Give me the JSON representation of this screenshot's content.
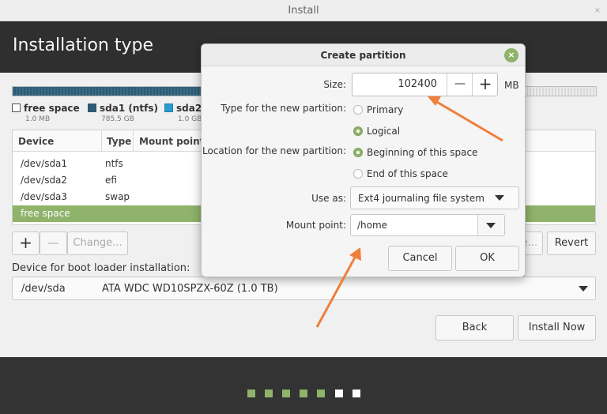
{
  "window": {
    "title": "Install",
    "close_glyph": "×"
  },
  "header": {
    "title": "Installation type"
  },
  "disk": {
    "legend": [
      {
        "name": "free space",
        "size": "1.0 MB",
        "color": "#ffffff"
      },
      {
        "name": "sda1 (ntfs)",
        "size": "785.5 GB",
        "color": "#2d5a74"
      },
      {
        "name": "sda2",
        "size": "1.0 GB",
        "color": "#2a9bd0"
      }
    ]
  },
  "table": {
    "columns": [
      "Device",
      "Type",
      "Mount point"
    ],
    "rows": [
      {
        "device": "/dev/sda1",
        "type": "ntfs"
      },
      {
        "device": "/dev/sda2",
        "type": "efi"
      },
      {
        "device": "/dev/sda3",
        "type": "swap"
      },
      {
        "device": "free space",
        "type": ""
      }
    ],
    "partial_row_text": "free space"
  },
  "table_buttons": {
    "add": "+",
    "remove": "—",
    "change": "Change...",
    "new_table_partial": "e...",
    "revert": "Revert"
  },
  "boot": {
    "label": "Device for boot loader installation:",
    "device": "/dev/sda",
    "description": "ATA WDC WD10SPZX-60Z (1.0 TB)"
  },
  "nav": {
    "back": "Back",
    "install_now": "Install Now"
  },
  "progress_dots": [
    {
      "state": "done",
      "color": "#8fb36a"
    },
    {
      "state": "done",
      "color": "#8fb36a"
    },
    {
      "state": "done",
      "color": "#8fb36a"
    },
    {
      "state": "done",
      "color": "#8fb36a"
    },
    {
      "state": "done",
      "color": "#8fb36a"
    },
    {
      "state": "todo",
      "color": "#ffffff"
    },
    {
      "state": "todo",
      "color": "#ffffff"
    }
  ],
  "dialog": {
    "title": "Create partition",
    "close_glyph": "×",
    "size_label": "Size:",
    "size_value": "102400",
    "size_unit": "MB",
    "minus": "—",
    "plus": "+",
    "type_label": "Type for the new partition:",
    "type_options": [
      "Primary",
      "Logical"
    ],
    "type_selected": "Logical",
    "location_label": "Location for the new partition:",
    "location_options": [
      "Beginning of this space",
      "End of this space"
    ],
    "location_selected": "Beginning of this space",
    "use_as_label": "Use as:",
    "use_as_value": "Ext4 journaling file system",
    "mount_label": "Mount point:",
    "mount_value": "/home",
    "cancel": "Cancel",
    "ok": "OK"
  },
  "colors": {
    "accent": "#8fb36a",
    "header": "#2f2f2f",
    "annotation_arrow": "#f07f3c"
  }
}
